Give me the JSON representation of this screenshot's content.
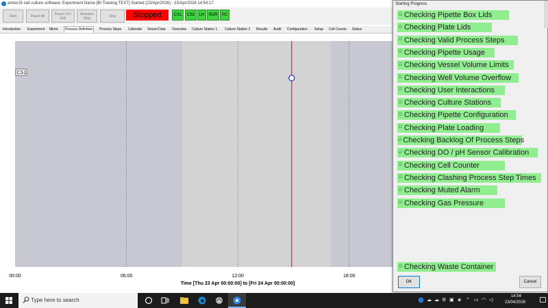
{
  "window": {
    "title": "amtor15 cell culture software: Experiment Name [BI Training TEST] Started (23/Apr/2026) : 23/Apr/2026 14:54:17"
  },
  "toolbar": {
    "start": "Start",
    "pause_all": "Pause All",
    "pause_lh_edit": "Pause LH / Edit",
    "abandon_step": "Abandon Step",
    "stop": "Stop",
    "status": "Stopped",
    "indicators": [
      "CS1",
      "CS2",
      "LH",
      "RDR",
      "PC"
    ]
  },
  "tabs": [
    "Introduction",
    "Experiment",
    "Mimic",
    "Process Definition",
    "Process Steps",
    "Calendar",
    "Vessel Data",
    "Overview",
    "Culture Station 1",
    "Culture Station 2",
    "Results",
    "Audit",
    "Configuration",
    "Setup",
    "Cell Counts",
    "Status"
  ],
  "active_tab": "Process Definition",
  "chart": {
    "row_label": "CS1",
    "x_ticks": [
      "00:00",
      "06:00",
      "12:00",
      "18:00"
    ],
    "x_title": "Time [Thu 23 Apr 00:00:00] to [Fri 24 Apr 00:00:00]",
    "colors": {
      "plot_bg": "#c8c8d2",
      "highlight": "#d3d3d3",
      "now_line": "#e00000",
      "marker": "#1f3fcf"
    }
  },
  "chart_data": {
    "type": "gantt",
    "x_range_hours": [
      0,
      24
    ],
    "x_ticks": [
      "00:00",
      "06:00",
      "12:00",
      "18:00"
    ],
    "xlabel": "Time [Thu 23 Apr 00:00:00] to [Fri 24 Apr 00:00:00]",
    "rows": [
      "CS1"
    ],
    "shaded_period_hours": [
      9,
      17
    ],
    "current_time_hours": 14.9,
    "markers": [
      {
        "row": "CS1",
        "hour": 14.9
      }
    ]
  },
  "dialog": {
    "title": "Starting Progress",
    "checks": [
      "Checking Pipette Box Lids",
      "Checking Plate Lids",
      "Checking Valid Process Steps",
      "Checking Pipette Usage",
      "Checking Vessel Volume Limits",
      "Checking Well Volume Overflow",
      "Checking User Interactions",
      "Checking Culture Stations",
      "Checking Pipette Configuration",
      "Checking Plate Loading",
      "Checking Backlog Of Process Steps",
      "Checking DO / pH Sensor Calibration",
      "Checking Cell Counter",
      "Checking Clashing Process Step Times",
      "Checking Muted Alarm",
      "Checking Gas Pressure"
    ],
    "last_check": "Checking Waste Container",
    "check_color": "#90ee90",
    "ok": "OK",
    "cancel": "Cancel"
  },
  "taskbar": {
    "search_placeholder": "Type here to search",
    "time": "14:54",
    "date": "23/04/2026"
  }
}
